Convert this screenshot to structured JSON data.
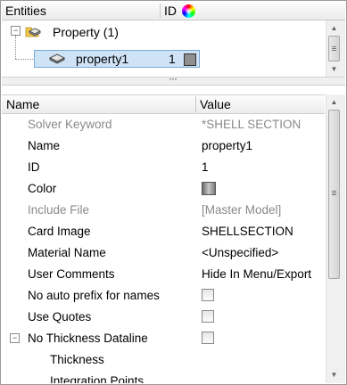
{
  "entities": {
    "title": "Entities",
    "col_id": "ID",
    "color_icon": "color-wheel-icon"
  },
  "tree": {
    "root": {
      "expander": "−",
      "label": "Property (1)",
      "icon": "property-folder-icon"
    },
    "child": {
      "label": "property1",
      "id": "1",
      "color_hex": "#8f8f8f",
      "icon": "shell-property-icon"
    }
  },
  "splitter": {
    "grip": "···"
  },
  "grid": {
    "col_name": "Name",
    "col_value": "Value",
    "rows": {
      "solver_keyword": {
        "name": "Solver Keyword",
        "value": "*SHELL SECTION"
      },
      "name": {
        "name": "Name",
        "value": "property1"
      },
      "id": {
        "name": "ID",
        "value": "1"
      },
      "color": {
        "name": "Color",
        "value_color": "#8f8f8f"
      },
      "include_file": {
        "name": "Include File",
        "value": "[Master Model]"
      },
      "card_image": {
        "name": "Card Image",
        "value": "SHELLSECTION"
      },
      "material_name": {
        "name": "Material Name",
        "value": "<Unspecified>"
      },
      "user_comments": {
        "name": "User Comments",
        "value": "Hide In Menu/Export"
      },
      "no_auto_prefix": {
        "name": "No auto prefix for names",
        "checked": false
      },
      "use_quotes": {
        "name": "Use Quotes",
        "checked": false
      },
      "no_thickness_dataline": {
        "name": "No Thickness Dataline",
        "expander": "−",
        "checked": false
      },
      "thickness": {
        "name": "Thickness"
      },
      "integration_points": {
        "name": "Integration Points"
      }
    }
  },
  "scrollbar": {
    "up": "▲",
    "down": "▼",
    "grip_icon": "scroll-grip-icon"
  }
}
